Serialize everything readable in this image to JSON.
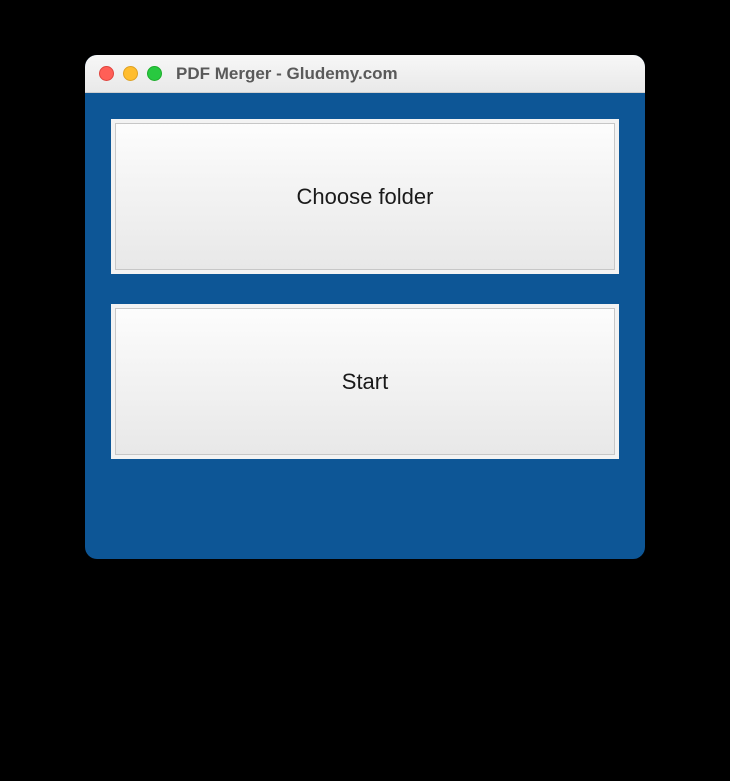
{
  "window": {
    "title": "PDF Merger - Gludemy.com"
  },
  "buttons": {
    "choose_folder_label": "Choose folder",
    "start_label": "Start"
  },
  "traffic_lights": {
    "close": "close",
    "minimize": "minimize",
    "maximize": "maximize"
  }
}
